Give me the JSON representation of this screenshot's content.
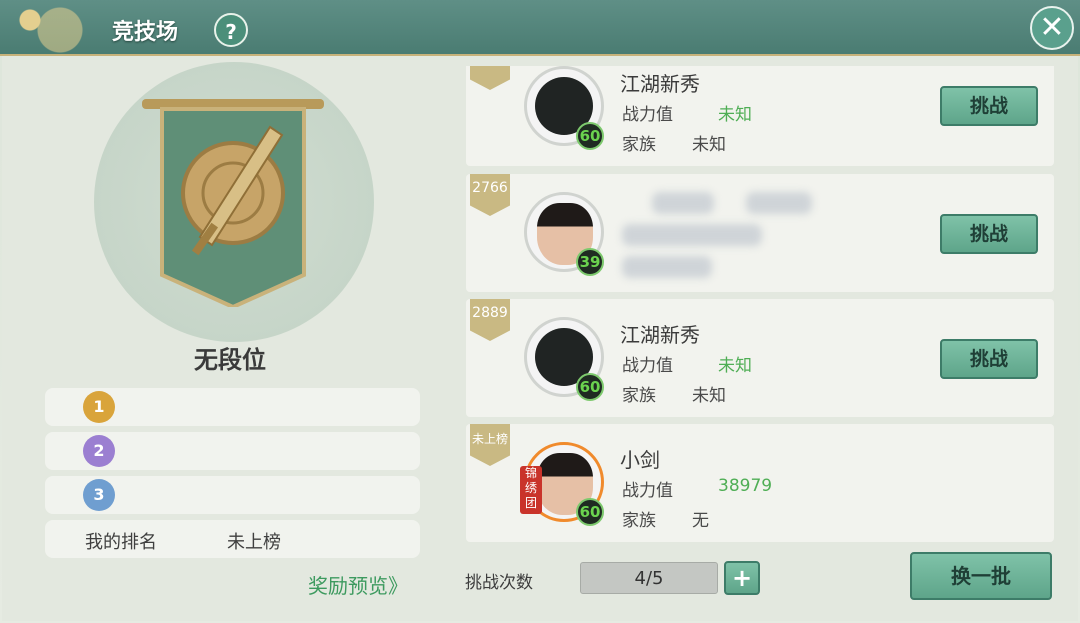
{
  "header": {
    "title": "竞技场",
    "help_icon": "?",
    "close_icon": "✕"
  },
  "left": {
    "rank_title": "无段位",
    "medals": [
      "1",
      "2",
      "3"
    ],
    "my_rank_label": "我的排名",
    "my_rank_value": "未上榜",
    "reward_link": "奖励预览》"
  },
  "opponents": [
    {
      "rank": "",
      "name": "江湖新秀",
      "power_label": "战力值",
      "power": "未知",
      "family_label": "家族",
      "family": "未知",
      "level": "60",
      "avatar": "silhouette-icon",
      "button": "挑战"
    },
    {
      "rank": "2766",
      "name": "",
      "power_label": "",
      "power": "",
      "family_label": "",
      "family": "",
      "level": "39",
      "avatar": "portrait-male",
      "button": "挑战"
    },
    {
      "rank": "2889",
      "name": "江湖新秀",
      "power_label": "战力值",
      "power": "未知",
      "family_label": "家族",
      "family": "未知",
      "level": "60",
      "avatar": "silhouette-icon",
      "button": "挑战"
    },
    {
      "rank": "未上榜",
      "name": "小剑",
      "power_label": "战力值",
      "power": "38979",
      "family_label": "家族",
      "family": "无",
      "level": "60",
      "avatar": "portrait-self",
      "badge": "锦绣团",
      "button": ""
    }
  ],
  "footer": {
    "tries_label": "挑战次数",
    "tries_value": "4/5",
    "plus_label": "+",
    "refresh_label": "换一批"
  },
  "colors": {
    "accent": "#5ea58a",
    "title_bar": "#4a7c72",
    "positive_text": "#4fae55"
  }
}
